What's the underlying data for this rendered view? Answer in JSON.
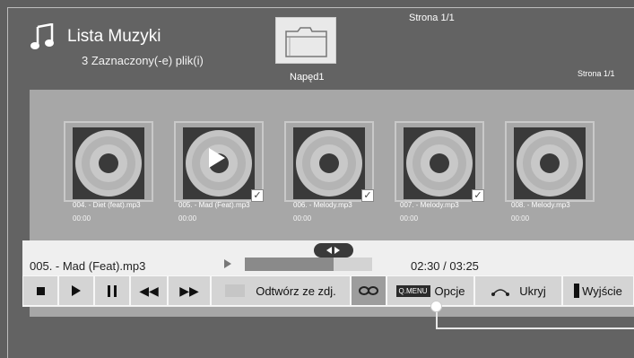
{
  "header": {
    "title": "Lista Muzyki",
    "subtitle": "3 Zaznaczony(-e) plik(i)",
    "page_top": "Strona 1/1",
    "page_right": "Strona 1/1",
    "drive_label": "Napęd1"
  },
  "items": [
    {
      "name": "004. - Diet (feat).mp3",
      "time": "00:00",
      "checked": false,
      "playing": false
    },
    {
      "name": "005. - Mad (Feat).mp3",
      "time": "00:00",
      "checked": true,
      "playing": true
    },
    {
      "name": "006. - Melody.mp3",
      "time": "00:00",
      "checked": true,
      "playing": false
    },
    {
      "name": "007. - Melody.mp3",
      "time": "00:00",
      "checked": true,
      "playing": false
    },
    {
      "name": "008. - Melody.mp3",
      "time": "00:00",
      "checked": false,
      "playing": false
    }
  ],
  "player": {
    "track": "005. - Mad (Feat).mp3",
    "time": "02:30 / 03:25",
    "progress": 0.7
  },
  "controls": {
    "slideshow": "Odtwórz ze zdj.",
    "qmenu": "Q.MENU",
    "options": "Opcje",
    "hide": "Ukryj",
    "exit": "Wyjście"
  }
}
